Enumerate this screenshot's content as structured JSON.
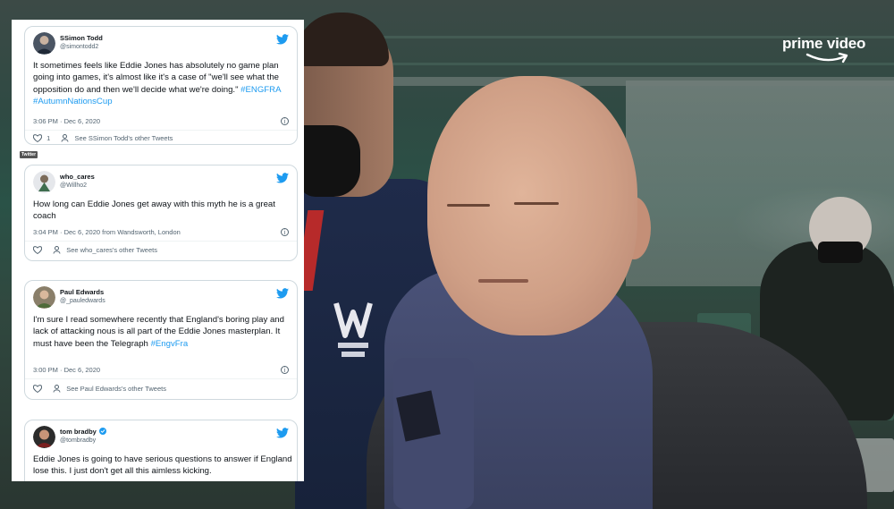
{
  "broadcaster": {
    "logo_text": "prime video"
  },
  "twitter_label": "Twitter",
  "tweets": [
    {
      "name": "SSimon Todd",
      "handle": "@simontodd2",
      "verified": false,
      "text_plain": "It sometimes feels like Eddie Jones has absolutely no game plan going into games, it's almost like it's a case of \"we'll see what the opposition do and then we'll decide what we're doing.\" ",
      "hashtags": "#ENGFRA #AutumnNationsCup",
      "timestamp": "3:06 PM · Dec 6, 2020",
      "likes": "1",
      "see_more": "See SSimon Todd's other Tweets"
    },
    {
      "name": "who_cares",
      "handle": "@Willho2",
      "verified": false,
      "text_plain": "How long can Eddie Jones get away with this myth he is a great coach",
      "hashtags": "",
      "timestamp": "3:04 PM · Dec 6, 2020 from Wandsworth, London",
      "likes": "",
      "see_more": "See who_cares's other Tweets"
    },
    {
      "name": "Paul Edwards",
      "handle": "@_pauledwards",
      "verified": false,
      "text_plain": "I'm sure I read somewhere recently that England's boring play and lack of attacking nous is all part of the Eddie Jones masterplan. It must have been the Telegraph ",
      "hashtags": "#EngvFra",
      "timestamp": "3:00 PM · Dec 6, 2020",
      "likes": "",
      "see_more": "See Paul Edwards's other Tweets"
    },
    {
      "name": "tom bradby",
      "handle": "@tombradby",
      "verified": true,
      "text_plain": "Eddie Jones is going to have serious questions to answer if England lose this.  I just don't get all this aimless kicking.",
      "hashtags": "",
      "timestamp": "",
      "likes": "",
      "see_more": ""
    }
  ],
  "colors": {
    "twitter_blue": "#1d9bf0",
    "text_primary": "#0f1419",
    "text_secondary": "#536471",
    "border": "#cfd9de"
  }
}
